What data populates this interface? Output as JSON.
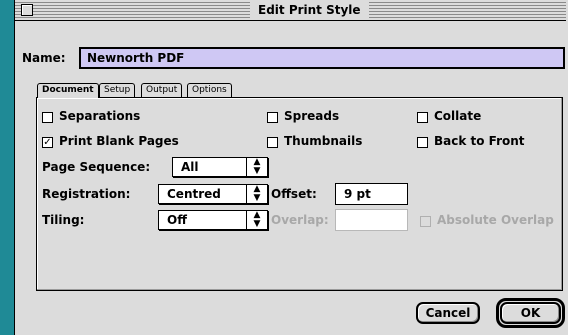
{
  "window": {
    "title": "Edit Print Style"
  },
  "name": {
    "label": "Name:",
    "value": "Newnorth PDF"
  },
  "tabs": [
    {
      "label": "Document",
      "active": true
    },
    {
      "label": "Setup",
      "active": false
    },
    {
      "label": "Output",
      "active": false
    },
    {
      "label": "Options",
      "active": false
    }
  ],
  "checkboxes": {
    "separations": {
      "label": "Separations",
      "checked": false
    },
    "spreads": {
      "label": "Spreads",
      "checked": false
    },
    "collate": {
      "label": "Collate",
      "checked": false
    },
    "print_blank_pages": {
      "label": "Print Blank Pages",
      "checked": true
    },
    "thumbnails": {
      "label": "Thumbnails",
      "checked": false
    },
    "back_to_front": {
      "label": "Back to Front",
      "checked": false
    },
    "absolute_overlap": {
      "label": "Absolute Overlap",
      "checked": false,
      "enabled": false
    }
  },
  "page_sequence": {
    "label": "Page Sequence:",
    "value": "All"
  },
  "registration": {
    "label": "Registration:",
    "value": "Centred"
  },
  "offset": {
    "label": "Offset:",
    "value": "9 pt"
  },
  "tiling": {
    "label": "Tiling:",
    "value": "Off"
  },
  "overlap": {
    "label": "Overlap:",
    "value": "",
    "enabled": false
  },
  "buttons": {
    "cancel": "Cancel",
    "ok": "OK"
  },
  "colors": {
    "name_field_bg": "#cfc8f4",
    "desktop_edge": "#1f8a96"
  }
}
